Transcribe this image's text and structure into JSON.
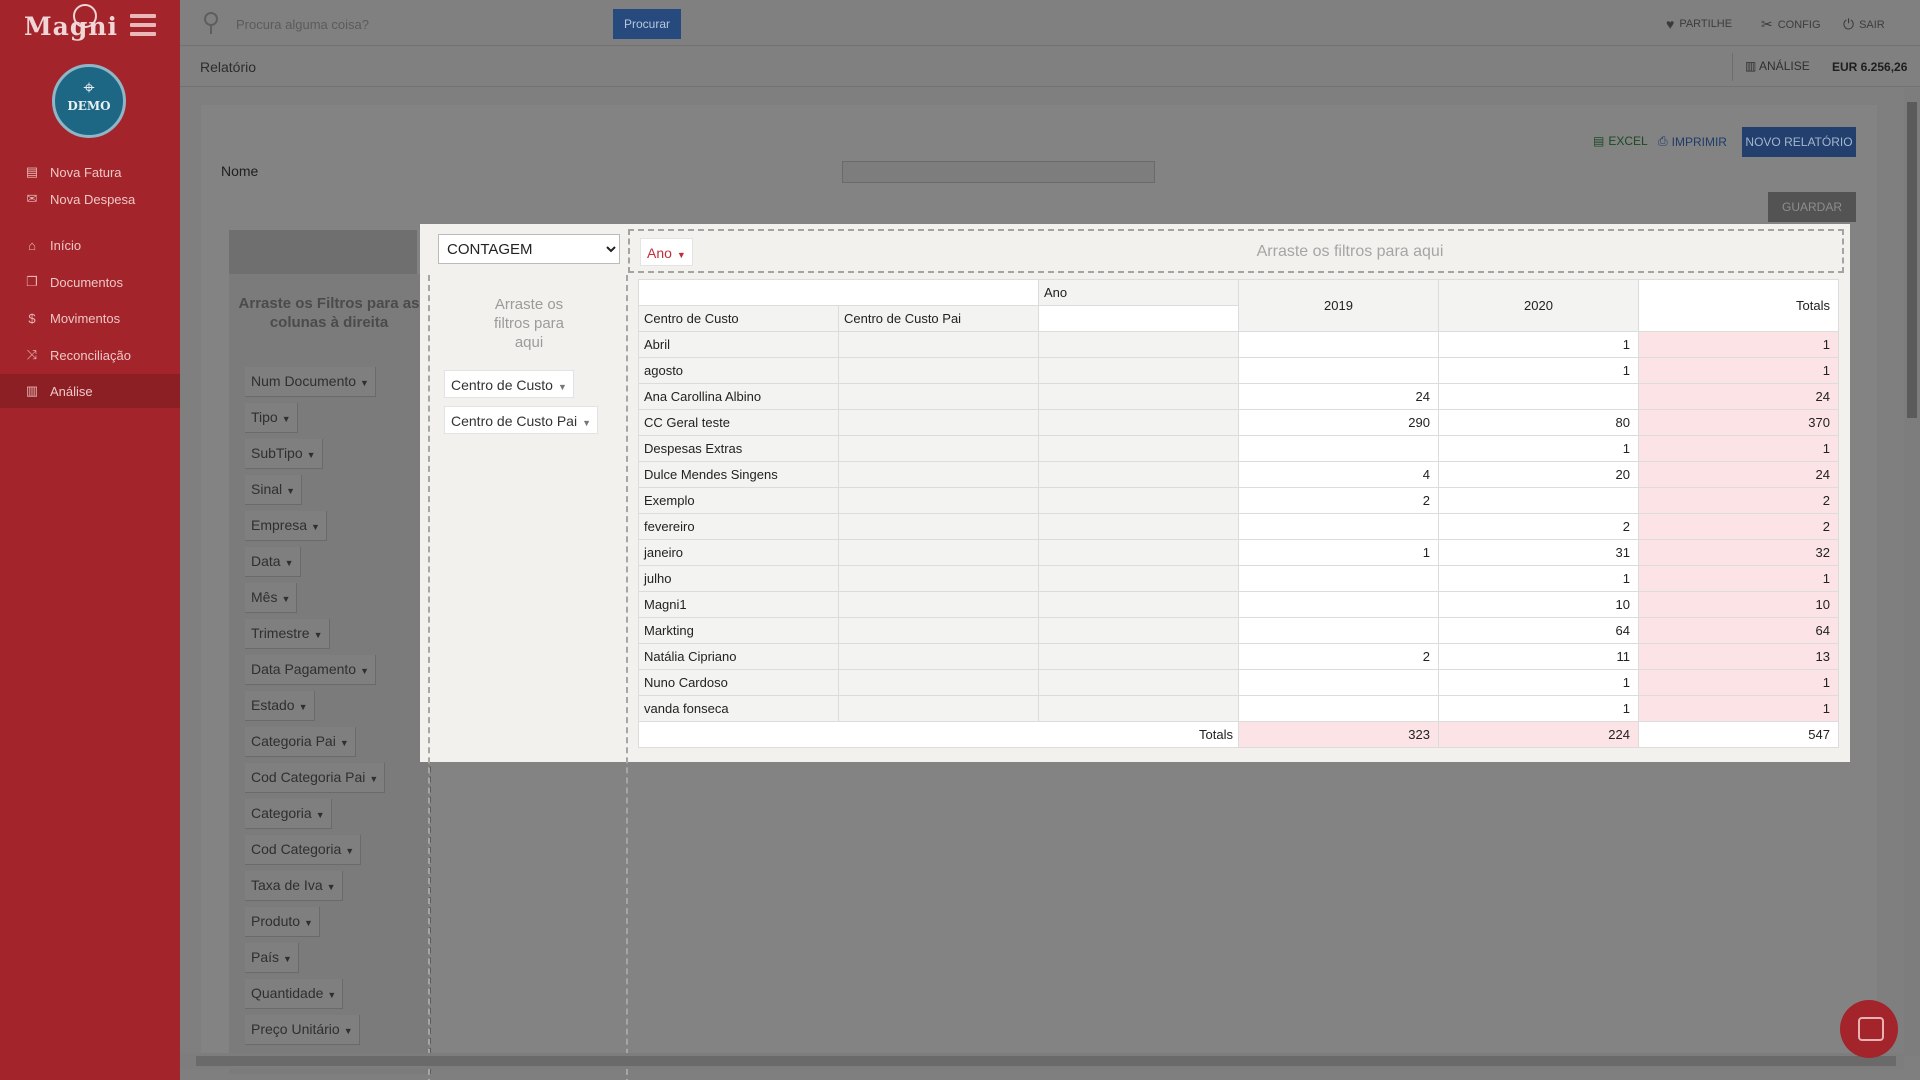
{
  "app": {
    "logo": "Magni",
    "badge": "DEMO"
  },
  "sidebar": {
    "items": [
      {
        "label": "Nova Fatura",
        "icon": "file-icon"
      },
      {
        "label": "Nova Despesa",
        "icon": "expense-icon"
      },
      {
        "label": "Início",
        "icon": "home-icon"
      },
      {
        "label": "Documentos",
        "icon": "documents-icon"
      },
      {
        "label": "Movimentos",
        "icon": "dollar-icon"
      },
      {
        "label": "Reconciliação",
        "icon": "shuffle-icon"
      },
      {
        "label": "Análise",
        "icon": "bar-chart-icon",
        "active": true
      }
    ]
  },
  "topbar": {
    "search_placeholder": "Procura alguma coisa?",
    "search_button": "Procurar",
    "partilhe": "PARTILHE",
    "config": "CONFIG",
    "sair": "SAIR"
  },
  "subbar": {
    "breadcrumb": "Relatório",
    "analise": "ANÁLISE",
    "balance": "EUR 6.256,26"
  },
  "report": {
    "excel": "EXCEL",
    "imprimir": "IMPRIMIR",
    "novo": "NOVO RELATÓRIO",
    "nome_label": "Nome",
    "nome_value": "",
    "guardar": "GUARDAR"
  },
  "attributes": {
    "hint": "Arraste os Filtros para as colunas à direita",
    "items": [
      "Num Documento",
      "Tipo",
      "SubTipo",
      "Sinal",
      "Empresa",
      "Data",
      "Mês",
      "Trimestre",
      "Data Pagamento",
      "Estado",
      "Categoria Pai",
      "Cod Categoria Pai",
      "Categoria",
      "Cod Categoria",
      "Taxa de Iva",
      "Produto",
      "País",
      "Quantidade",
      "Preço Unitário"
    ]
  },
  "pivot": {
    "aggregator": "CONTAGEM",
    "aggregator_options": [
      "CONTAGEM"
    ],
    "col_filter": "Ano",
    "col_hint": "Arraste os filtros para aqui",
    "row_hint": "Arraste os filtros para aqui",
    "row_filters": [
      "Centro de Custo",
      "Centro de Custo Pai"
    ],
    "header": {
      "col_attr": "Ano",
      "row_attr1": "Centro de Custo",
      "row_attr2": "Centro de Custo Pai",
      "years": [
        "2019",
        "2020"
      ],
      "totals": "Totals"
    },
    "rows": [
      {
        "name": "Abril",
        "y2019": "",
        "y2020": "1",
        "total": "1"
      },
      {
        "name": "agosto",
        "y2019": "",
        "y2020": "1",
        "total": "1"
      },
      {
        "name": "Ana Carollina Albino",
        "y2019": "24",
        "y2020": "",
        "total": "24"
      },
      {
        "name": "CC Geral teste",
        "y2019": "290",
        "y2020": "80",
        "total": "370"
      },
      {
        "name": "Despesas Extras",
        "y2019": "",
        "y2020": "1",
        "total": "1"
      },
      {
        "name": "Dulce Mendes Singens",
        "y2019": "4",
        "y2020": "20",
        "total": "24"
      },
      {
        "name": "Exemplo",
        "y2019": "2",
        "y2020": "",
        "total": "2"
      },
      {
        "name": "fevereiro",
        "y2019": "",
        "y2020": "2",
        "total": "2"
      },
      {
        "name": "janeiro",
        "y2019": "1",
        "y2020": "31",
        "total": "32"
      },
      {
        "name": "julho",
        "y2019": "",
        "y2020": "1",
        "total": "1"
      },
      {
        "name": "Magni1",
        "y2019": "",
        "y2020": "10",
        "total": "10"
      },
      {
        "name": "Markting",
        "y2019": "",
        "y2020": "64",
        "total": "64"
      },
      {
        "name": "Natália Cipriano",
        "y2019": "2",
        "y2020": "11",
        "total": "13"
      },
      {
        "name": "Nuno Cardoso",
        "y2019": "",
        "y2020": "1",
        "total": "1"
      },
      {
        "name": "vanda fonseca",
        "y2019": "",
        "y2020": "1",
        "total": "1"
      }
    ],
    "totals": {
      "label": "Totals",
      "y2019": "323",
      "y2020": "224",
      "total": "547"
    }
  }
}
